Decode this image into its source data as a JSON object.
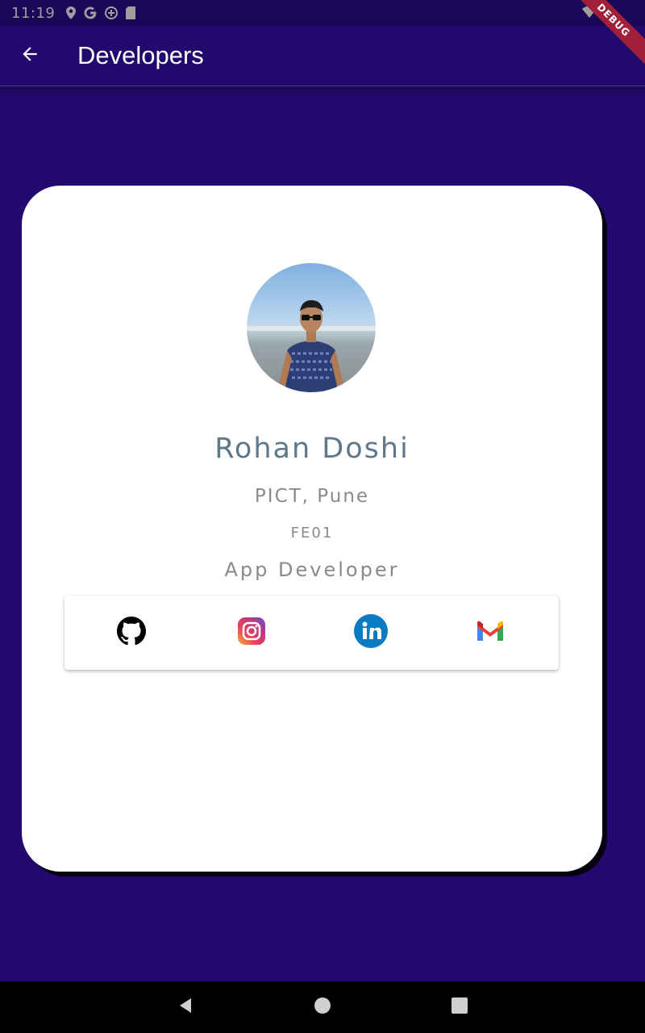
{
  "status_bar": {
    "time": "11:19"
  },
  "debug_banner": "DEBUG",
  "app_bar": {
    "title": "Developers",
    "back_icon": "arrow-back-icon"
  },
  "profile": {
    "name": "Rohan Doshi",
    "college": "PICT, Pune",
    "roll": "FE01",
    "role": "App Developer",
    "avatar_icon": "profile-photo"
  },
  "social_links": [
    {
      "icon": "github-icon"
    },
    {
      "icon": "instagram-icon"
    },
    {
      "icon": "linkedin-icon"
    },
    {
      "icon": "gmail-icon"
    }
  ],
  "colors": {
    "background": "#23096e",
    "card": "#ffffff",
    "name_text": "#5f7889",
    "secondary_text": "#8a8a8a"
  },
  "nav_bar": {
    "icons": [
      "back-triangle-icon",
      "home-circle-icon",
      "recents-square-icon"
    ]
  }
}
